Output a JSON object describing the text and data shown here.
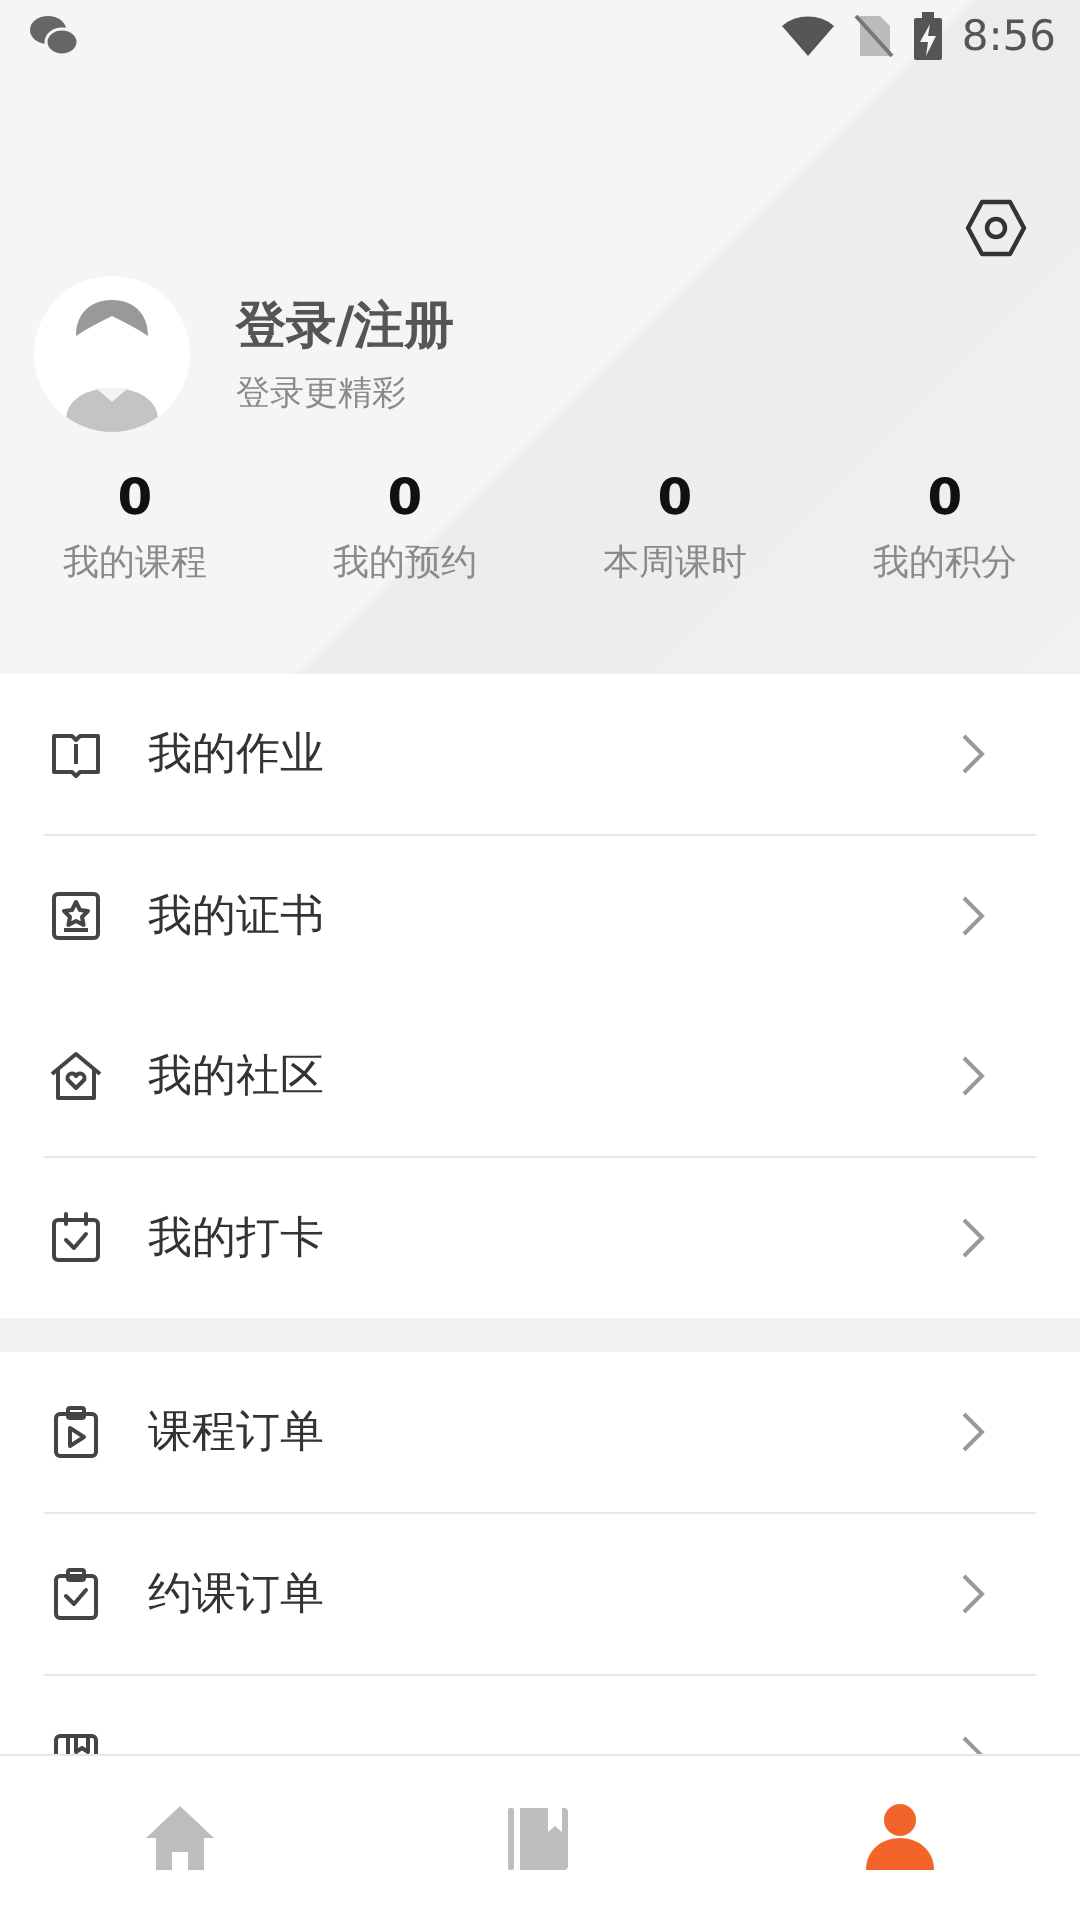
{
  "status_bar": {
    "time": "8:56"
  },
  "profile": {
    "name": "登录/注册",
    "subtitle": "登录更精彩"
  },
  "stats": [
    {
      "value": "0",
      "label": "我的课程"
    },
    {
      "value": "0",
      "label": "我的预约"
    },
    {
      "value": "0",
      "label": "本周课时"
    },
    {
      "value": "0",
      "label": "我的积分"
    }
  ],
  "menu_groups": [
    {
      "items": [
        {
          "kind": "homework",
          "label": "我的作业",
          "divider_below": true
        },
        {
          "kind": "certificate",
          "label": "我的证书",
          "divider_below": false
        },
        {
          "kind": "community",
          "label": "我的社区",
          "divider_below": true
        },
        {
          "kind": "checkin",
          "label": "我的打卡",
          "divider_below": false
        }
      ]
    },
    {
      "items": [
        {
          "kind": "course_order",
          "label": "课程订单",
          "divider_below": true
        },
        {
          "kind": "booking_order",
          "label": "约课订单",
          "divider_below": true
        },
        {
          "kind": "book_order",
          "divider_below": false
        }
      ]
    }
  ],
  "tab_bar": [
    {
      "kind": "home",
      "selected": false
    },
    {
      "kind": "books",
      "selected": false
    },
    {
      "kind": "profile",
      "selected": true
    }
  ]
}
